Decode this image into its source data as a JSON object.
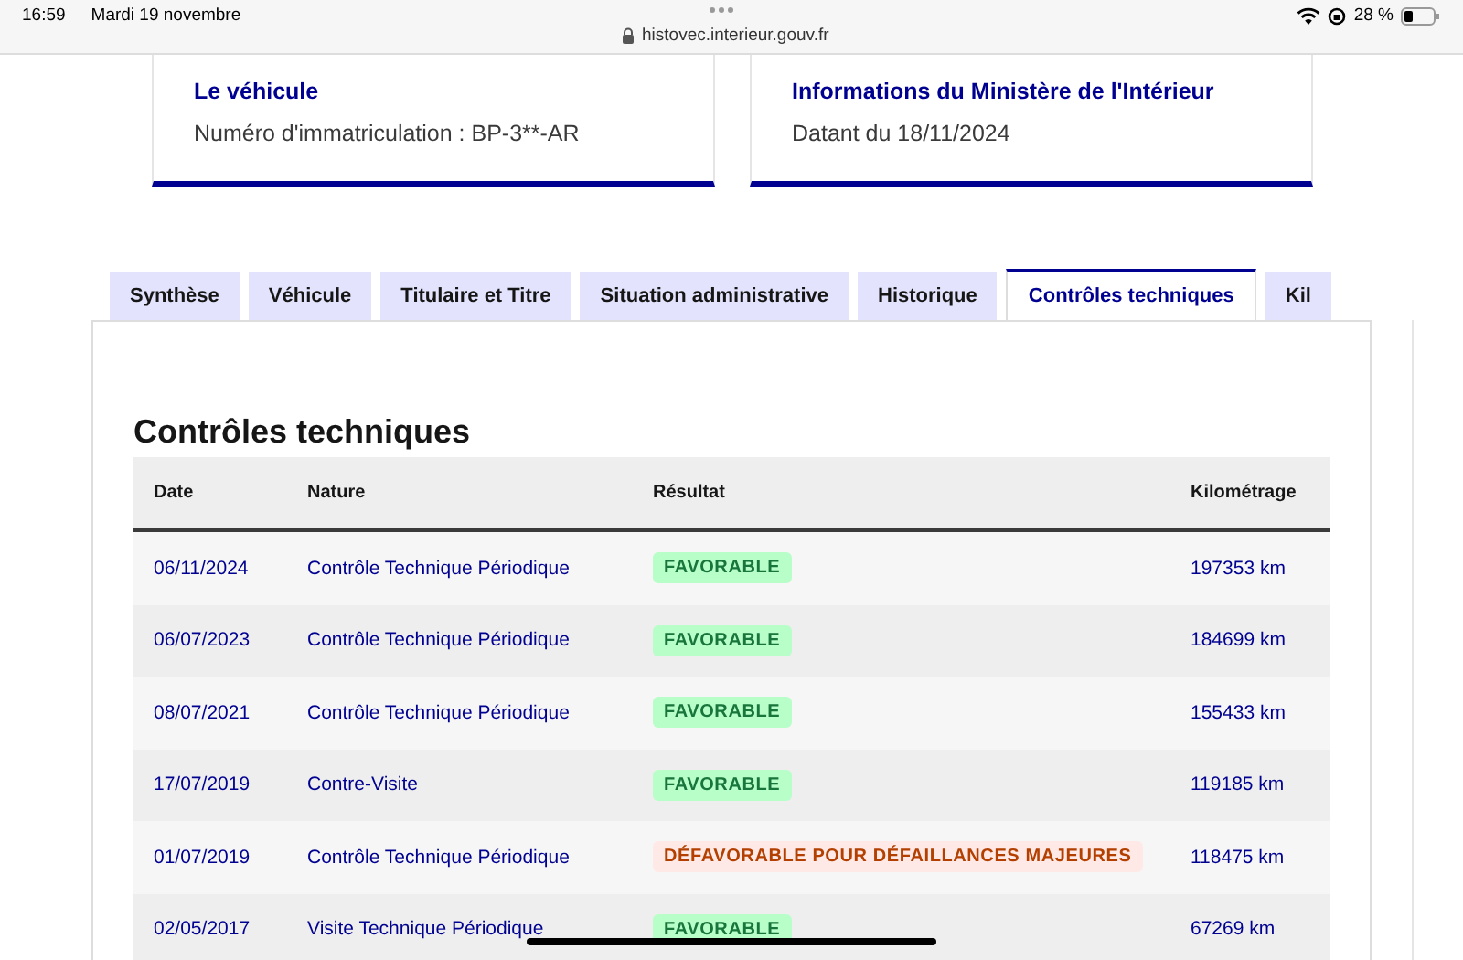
{
  "status_bar": {
    "time": "16:59",
    "date": "Mardi 19 novembre",
    "url": "histovec.interieur.gouv.fr",
    "battery": "28 %"
  },
  "cards": [
    {
      "title": "Le véhicule",
      "text": "Numéro d'immatriculation : BP-3**-AR"
    },
    {
      "title": "Informations du Ministère de l'Intérieur",
      "text": "Datant du 18/11/2024"
    }
  ],
  "tabs": [
    {
      "label": "Synthèse",
      "selected": false
    },
    {
      "label": "Véhicule",
      "selected": false
    },
    {
      "label": "Titulaire et Titre",
      "selected": false
    },
    {
      "label": "Situation administrative",
      "selected": false
    },
    {
      "label": "Historique",
      "selected": false
    },
    {
      "label": "Contrôles techniques",
      "selected": true
    },
    {
      "label": "Kil",
      "selected": false
    }
  ],
  "section_title": "Contrôles techniques",
  "table": {
    "columns": [
      "Date",
      "Nature",
      "Résultat",
      "Kilométrage"
    ],
    "rows": [
      {
        "date": "06/11/2024",
        "nature": "Contrôle Technique Périodique",
        "result": "FAVORABLE",
        "kind": "favorable",
        "km": "197353 km"
      },
      {
        "date": "06/07/2023",
        "nature": "Contrôle Technique Périodique",
        "result": "FAVORABLE",
        "kind": "favorable",
        "km": "184699 km"
      },
      {
        "date": "08/07/2021",
        "nature": "Contrôle Technique Périodique",
        "result": "FAVORABLE",
        "kind": "favorable",
        "km": "155433 km"
      },
      {
        "date": "17/07/2019",
        "nature": "Contre-Visite",
        "result": "FAVORABLE",
        "kind": "favorable",
        "km": "119185 km"
      },
      {
        "date": "01/07/2019",
        "nature": "Contrôle Technique Périodique",
        "result": "DÉFAVORABLE POUR DÉFAILLANCES MAJEURES",
        "kind": "unfavorable",
        "km": "118475 km"
      },
      {
        "date": "02/05/2017",
        "nature": "Visite Technique Périodique",
        "result": "FAVORABLE",
        "kind": "favorable",
        "km": "67269 km"
      }
    ]
  }
}
